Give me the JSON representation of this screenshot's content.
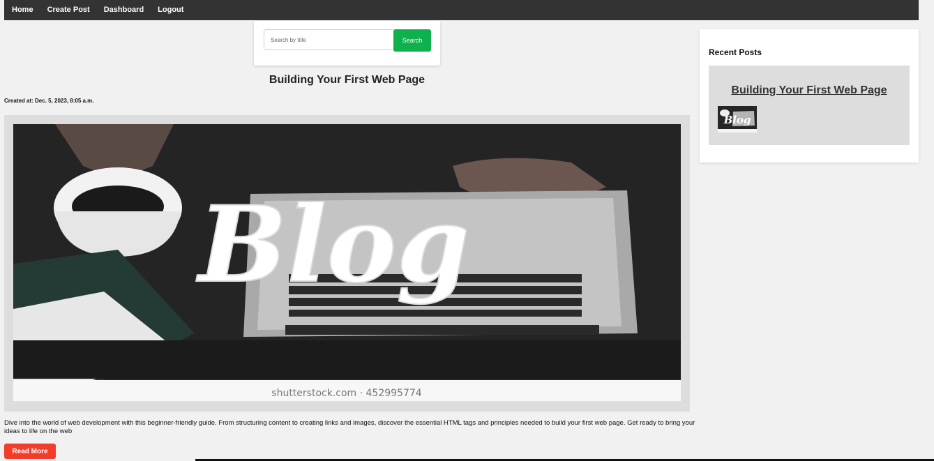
{
  "nav": {
    "items": [
      {
        "label": "Home"
      },
      {
        "label": "Create Post"
      },
      {
        "label": "Dashboard"
      },
      {
        "label": "Logout"
      }
    ]
  },
  "search": {
    "placeholder": "Search by title",
    "value": "",
    "button_label": "Search"
  },
  "post": {
    "title": "Building Your First Web Page",
    "created_at": "Created at: Dec. 5, 2023, 8:05 a.m.",
    "image_text": "Blog",
    "image_watermark": "shutterstock.com · 452995774",
    "excerpt": "Dive into the world of web development with this beginner-friendly guide. From structuring content to creating links and images, discover the essential HTML tags and principles needed to build your first web page. Get ready to bring your ideas to life on the web",
    "read_more_label": "Read More"
  },
  "sidebar": {
    "heading": "Recent Posts",
    "recent_posts": [
      {
        "title": "Building Your First Web Page",
        "thumb_text": "Blog"
      }
    ]
  },
  "colors": {
    "navbar": "#333333",
    "search_button": "#0fb14e",
    "read_more_button": "#f23d2b",
    "page_background": "#f1f1f1"
  }
}
